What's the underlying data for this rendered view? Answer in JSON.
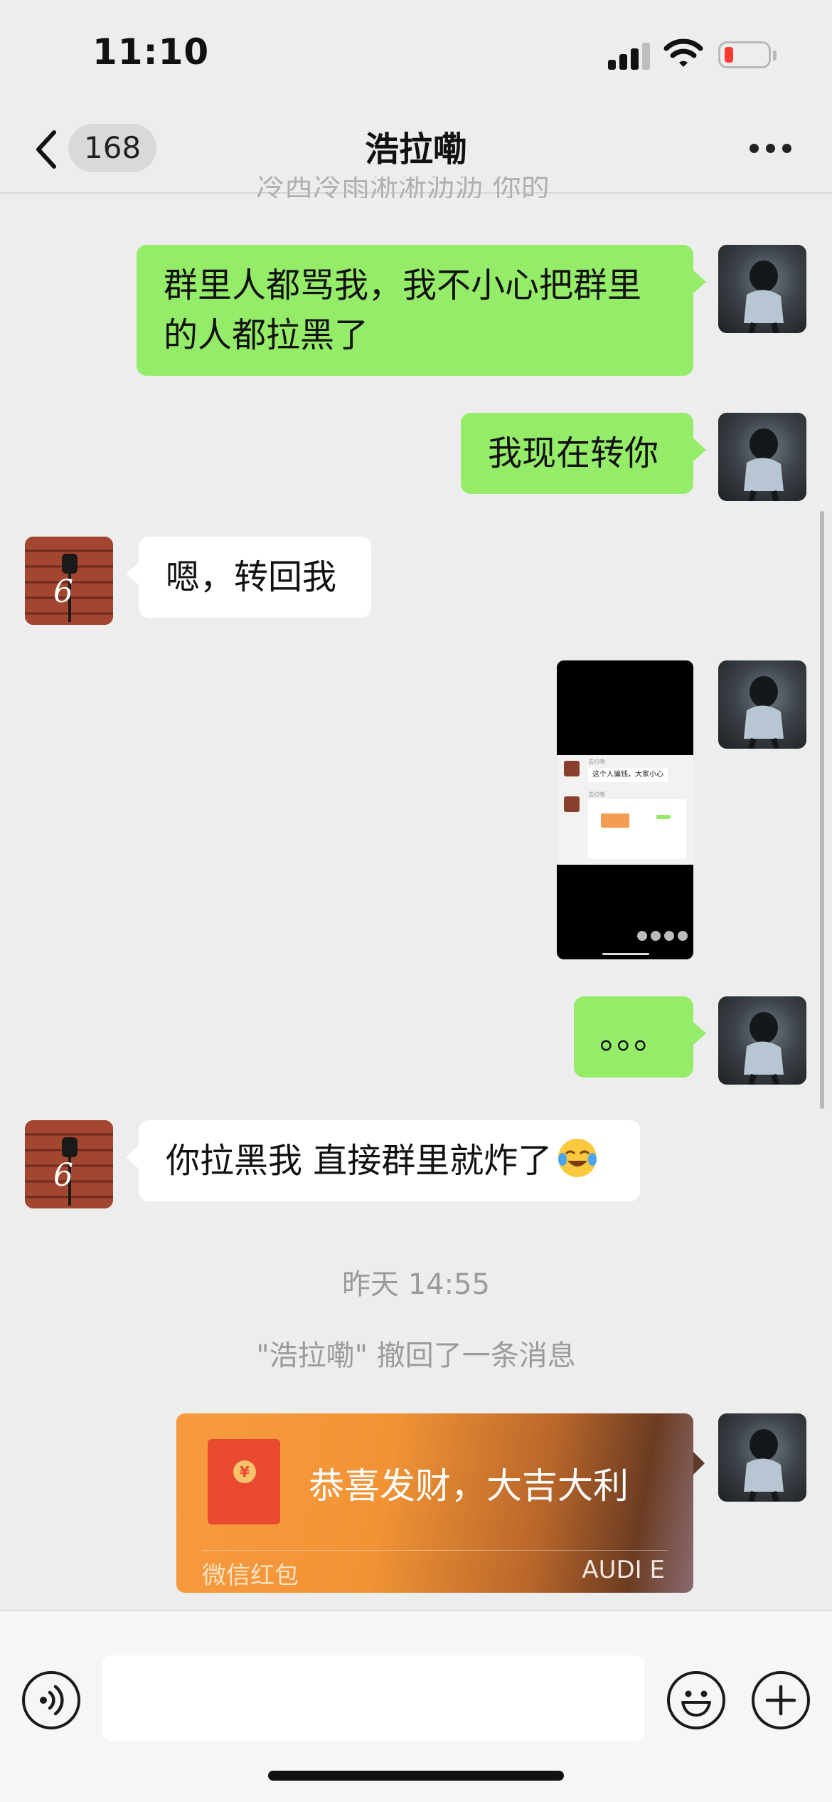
{
  "status_bar": {
    "time": "11:10"
  },
  "header": {
    "unread_count": "168",
    "title": "浩拉嘞"
  },
  "cutoff_line": "冷西冷雨淅淅沥沥 你的",
  "messages": {
    "m1": "群里人都骂我，我不小心把群里的人都拉黑了",
    "m2": "我现在转你",
    "m3": "嗯，转回我",
    "m4_image": {
      "name_1": "浩拉嘞",
      "bubble_1": "这个人骗钱，大家小心",
      "name_2": "浩拉嘞"
    },
    "m5": "。。。",
    "m6": "你拉黑我 直接群里就炸了"
  },
  "timestamp": "昨天 14:55",
  "recall_notice": "\"浩拉嘞\" 撤回了一条消息",
  "red_packet": {
    "greeting": "恭喜发财，大吉大利",
    "label": "微信红包",
    "tag": "AUDI E",
    "coin_symbol": "¥"
  },
  "input": {
    "placeholder": ""
  },
  "colors": {
    "bubble_me": "#95ec69",
    "bubble_other": "#ffffff",
    "background": "#ededed",
    "red_packet": "#f79a3e"
  },
  "icons": [
    "back-chevron-icon",
    "more-icon",
    "voice-icon",
    "emoji-icon",
    "plus-icon",
    "signal-icon",
    "wifi-icon",
    "battery-icon"
  ]
}
